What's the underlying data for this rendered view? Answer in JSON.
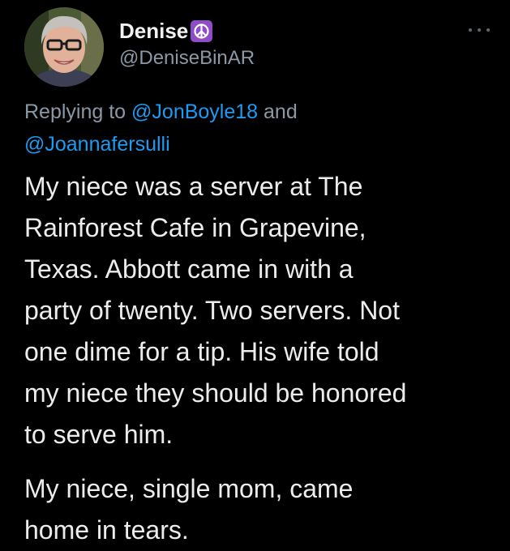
{
  "user": {
    "display_name": "Denise",
    "handle": "@DeniseBinAR",
    "badge_icon": "peace-sign-emoji",
    "avatar_icon": "profile-photo"
  },
  "more_icon": "ellipsis-icon",
  "reply": {
    "prefix": "Replying to",
    "mention_1": "@JonBoyle18",
    "conjunction": "and",
    "mention_2": "@Joannafersulli"
  },
  "tweet": {
    "paragraph_1": "My niece was a server at The\nRainforest Cafe in Grapevine,\nTexas. Abbott came in with a\nparty of twenty. Two servers. Not\none dime for a tip. His wife told\nmy niece they should be honored\nto serve him.",
    "paragraph_2": "My niece, single mom, came\nhome in tears."
  },
  "colors": {
    "background": "#000000",
    "text": "#e7e9ea",
    "muted": "#8b98a5",
    "link": "#1d9bf0",
    "badge": "#8f4cc7"
  }
}
